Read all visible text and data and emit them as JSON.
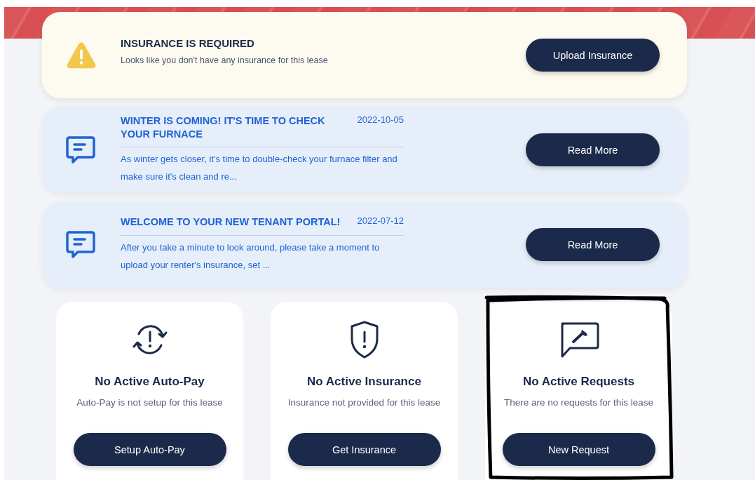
{
  "alert": {
    "title": "INSURANCE IS REQUIRED",
    "message": "Looks like you don't have any insurance for this lease",
    "button": "Upload Insurance"
  },
  "announcements": [
    {
      "title": "WINTER IS COMING! IT'S TIME TO CHECK YOUR FURNACE",
      "date": "2022-10-05",
      "excerpt": "As winter gets closer, it's time to double-check your furnace filter and make sure it's clean and re...",
      "button": "Read More"
    },
    {
      "title": "WELCOME TO YOUR NEW TENANT PORTAL!",
      "date": "2022-07-12",
      "excerpt": "After you take a minute to look around, please take a moment to upload your renter's insurance, set ...",
      "button": "Read More"
    }
  ],
  "status_cards": [
    {
      "kind": "autopay",
      "title": "No Active Auto-Pay",
      "subtitle": "Auto-Pay is not setup for this lease",
      "button": "Setup Auto-Pay",
      "highlighted": false
    },
    {
      "kind": "insurance",
      "title": "No Active Insurance",
      "subtitle": "Insurance not provided for this lease",
      "button": "Get Insurance",
      "highlighted": false
    },
    {
      "kind": "request",
      "title": "No Active Requests",
      "subtitle": "There are no requests for this lease",
      "button": "New Request",
      "highlighted": true
    }
  ]
}
